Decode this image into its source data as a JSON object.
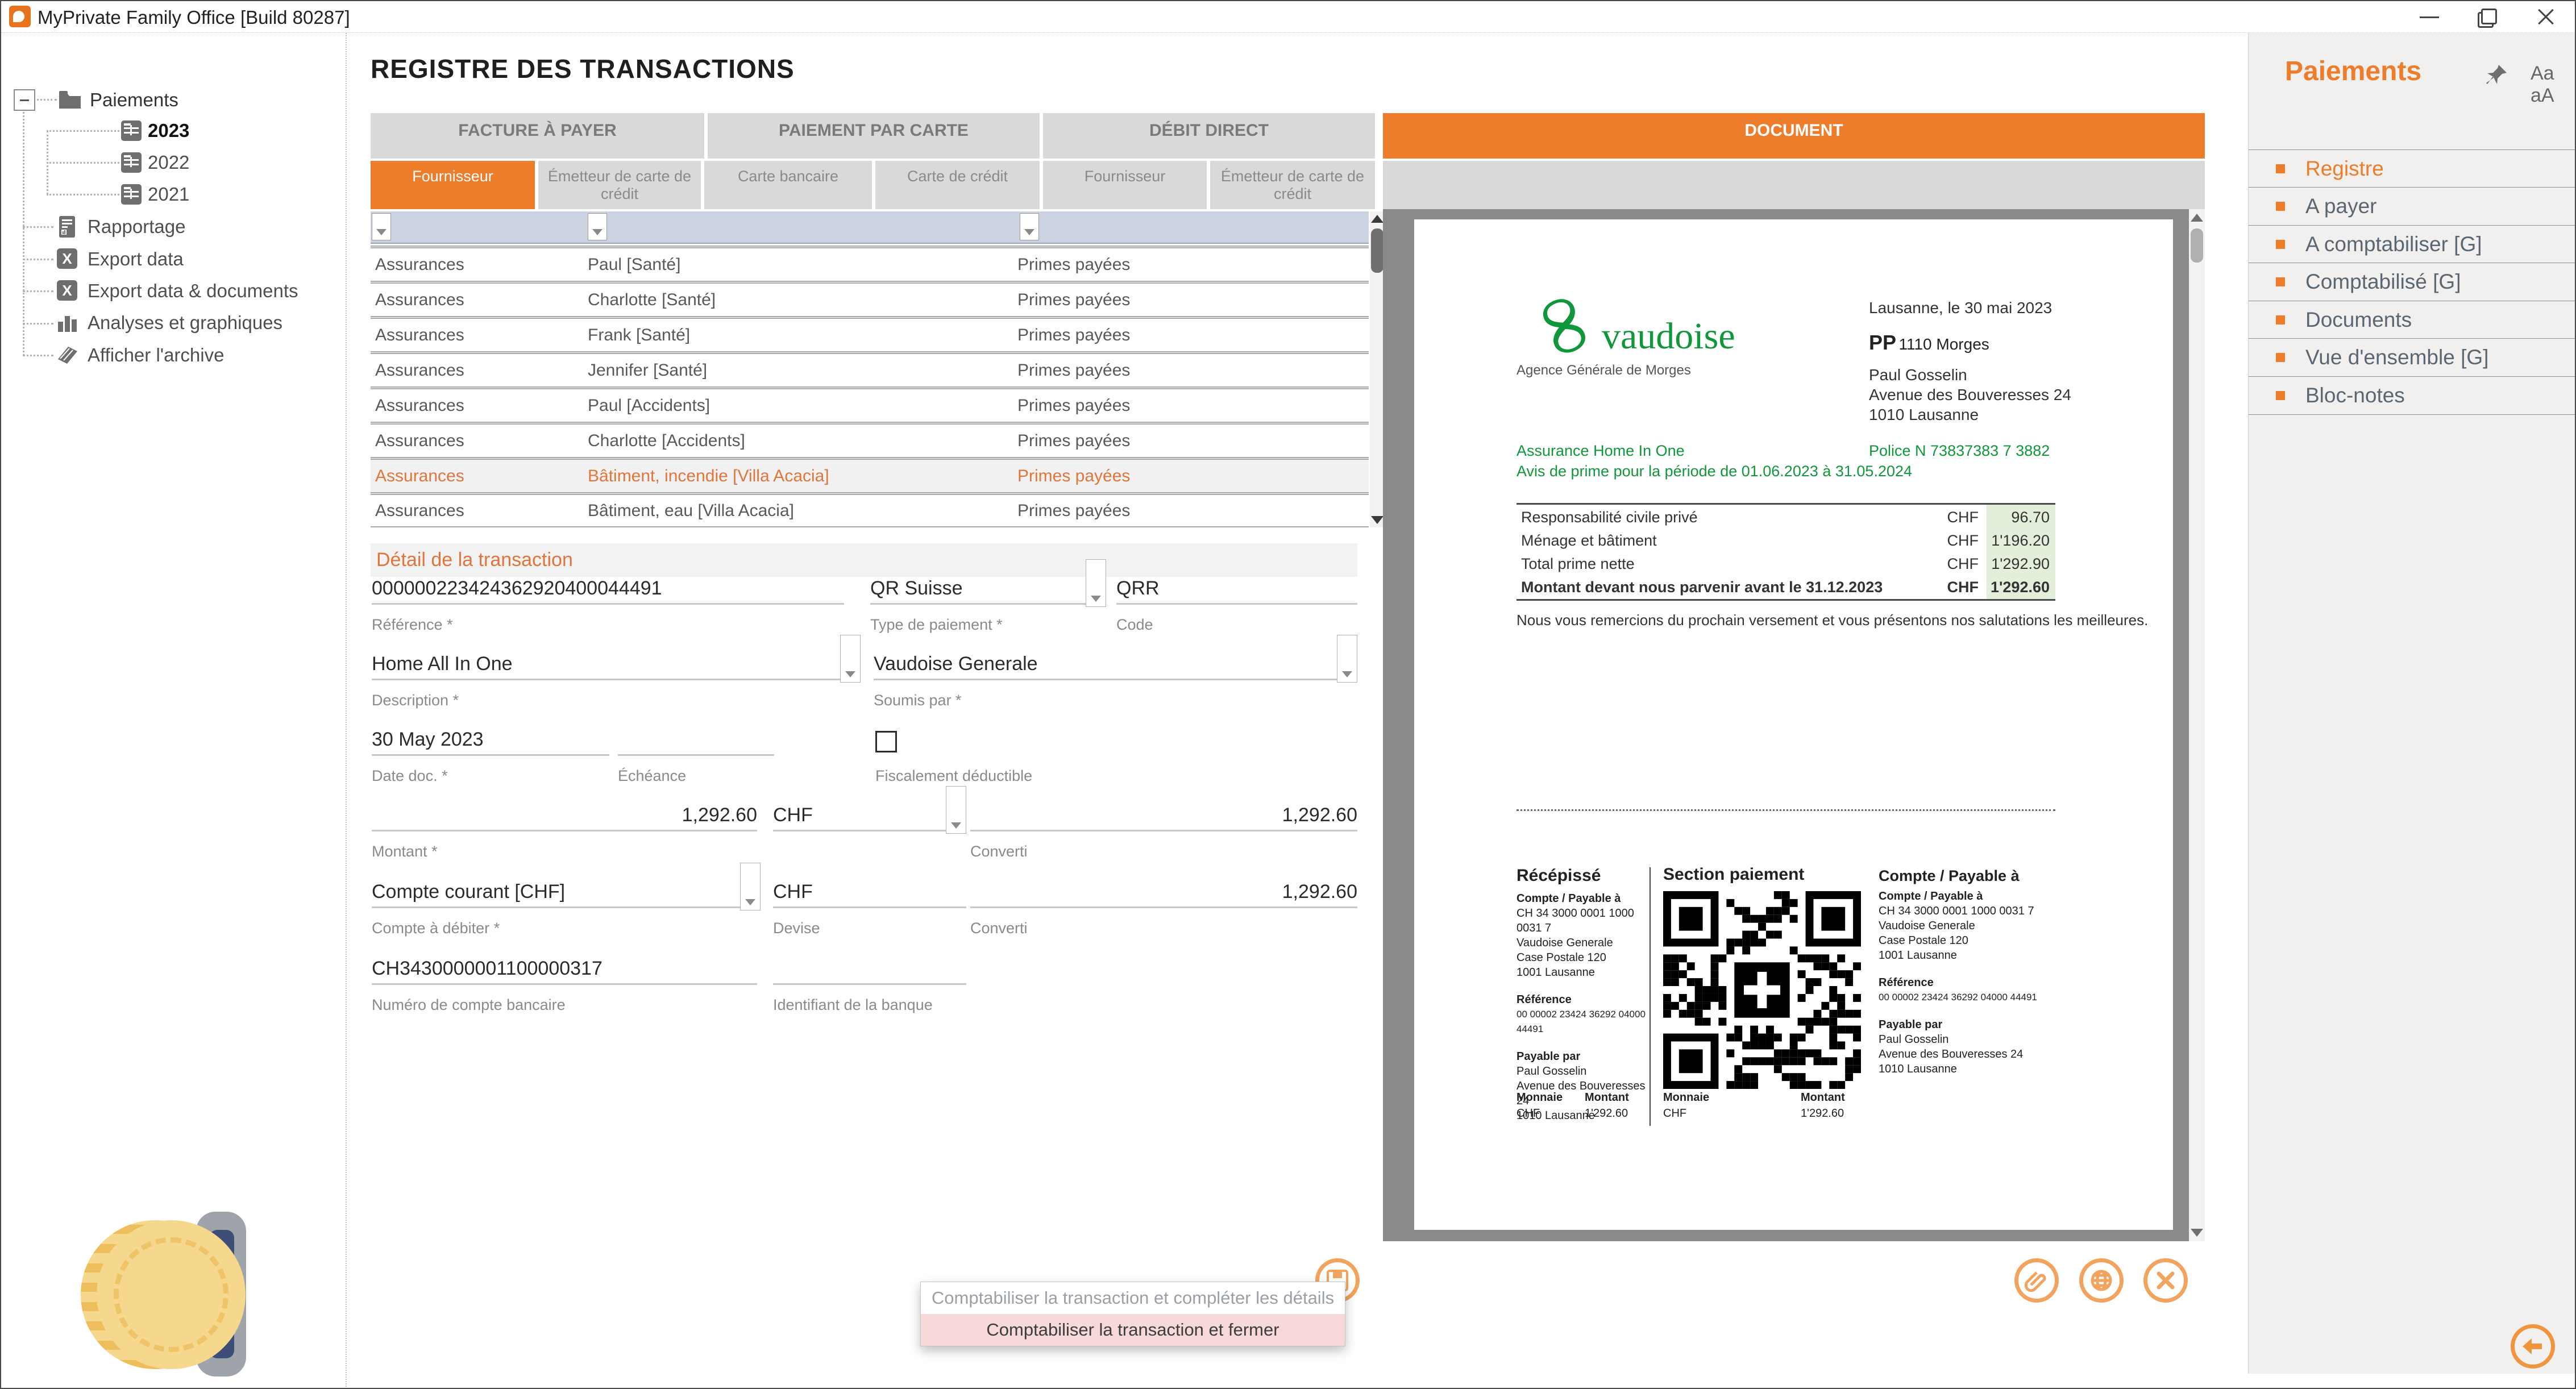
{
  "window": {
    "title": "MyPrivate Family Office [Build 80287]"
  },
  "colors": {
    "accent": "#ED7C2B",
    "doc_green": "#11973B",
    "amount_bg": "#E3EFDB",
    "popup_highlight": "#F7D9D9"
  },
  "tree": {
    "root": "Paiements",
    "years": [
      {
        "label": "2023",
        "active": true
      },
      {
        "label": "2022",
        "active": false
      },
      {
        "label": "2021",
        "active": false
      }
    ],
    "items": [
      "Rapportage",
      "Export data",
      "Export data & documents",
      "Analyses et graphiques",
      "Afficher l'archive"
    ]
  },
  "registre": {
    "title": "REGISTRE DES TRANSACTIONS",
    "groups": [
      "FACTURE À PAYER",
      "PAIEMENT PAR CARTE",
      "DÉBIT DIRECT",
      "DOCUMENT"
    ],
    "columns": [
      "Fournisseur",
      "Émetteur de carte de crédit",
      "Carte bancaire",
      "Carte de crédit",
      "Fournisseur",
      "Émetteur de carte de crédit"
    ],
    "rows": [
      {
        "fournisseur": "Assurances",
        "description": "Paul [Santé]",
        "statut": "Primes payées"
      },
      {
        "fournisseur": "Assurances",
        "description": "Charlotte [Santé]",
        "statut": "Primes payées"
      },
      {
        "fournisseur": "Assurances",
        "description": "Frank [Santé]",
        "statut": "Primes payées"
      },
      {
        "fournisseur": "Assurances",
        "description": "Jennifer [Santé]",
        "statut": "Primes payées"
      },
      {
        "fournisseur": "Assurances",
        "description": "Paul [Accidents]",
        "statut": "Primes payées"
      },
      {
        "fournisseur": "Assurances",
        "description": "Charlotte [Accidents]",
        "statut": "Primes payées"
      },
      {
        "fournisseur": "Assurances",
        "description": "Bâtiment, incendie [Villa Acacia]",
        "statut": "Primes payées",
        "selected": true
      },
      {
        "fournisseur": "Assurances",
        "description": "Bâtiment, eau [Villa Acacia]",
        "statut": "Primes payées"
      }
    ]
  },
  "detail": {
    "title": "Détail de la transaction",
    "reference": {
      "value": "000000223424362920400044491",
      "label": "Référence *"
    },
    "payment_type": {
      "value": "QR Suisse",
      "label": "Type de paiement *"
    },
    "code": {
      "value": "QRR",
      "label": "Code"
    },
    "description": {
      "value": "Home All In One",
      "label": "Description *"
    },
    "submitted_by": {
      "value": "Vaudoise Generale",
      "label": "Soumis par *"
    },
    "doc_date": {
      "value": "30 May 2023",
      "label": "Date doc. *"
    },
    "due_date": {
      "value": "",
      "label": "Échéance"
    },
    "tax_deductible": {
      "label": "Fiscalement déductible",
      "checked": false
    },
    "amount": {
      "value": "1,292.60",
      "label": "Montant *"
    },
    "currency": {
      "value": "CHF"
    },
    "converted": {
      "value": "1,292.60",
      "label": "Converti"
    },
    "debit_account": {
      "value": "Compte courant [CHF]",
      "label": "Compte à débiter *"
    },
    "account_currency": {
      "value": "CHF",
      "label": "Devise"
    },
    "converted2": {
      "value": "1,292.60",
      "label": "Converti"
    },
    "bank_account": {
      "value": "CH3430000001100000317",
      "label": "Numéro de compte bancaire"
    },
    "bank_id": {
      "value": "",
      "label": "Identifiant de la banque"
    }
  },
  "doc": {
    "header": "DOCUMENT",
    "brand": "vaudoise",
    "agency": "Agence Générale de Morges",
    "place_date": "Lausanne, le 30 mai 2023",
    "pp": "PP",
    "pp_city": "1110 Morges",
    "recipient": [
      "Paul Gosselin",
      "Avenue des Bouveresses 24",
      "1010 Lausanne"
    ],
    "policy_title": "Assurance Home In One",
    "policy_subtitle": "Avis de prime pour la période de 01.06.2023 à 31.05.2024",
    "policy_number": "Police N 73837383 7 3882",
    "amounts": [
      {
        "label": "Responsabilité civile privé",
        "currency": "CHF",
        "value": "96.70"
      },
      {
        "label": "Ménage et bâtiment",
        "currency": "CHF",
        "value": "1'196.20"
      },
      {
        "label": "Total prime nette",
        "currency": "CHF",
        "value": "1'292.90"
      },
      {
        "label": "Montant devant nous parvenir avant le 31.12.2023",
        "currency": "CHF",
        "value": "1'292.60"
      }
    ],
    "closing": "Nous vous remercions du prochain versement et vous présentons nos salutations les meilleures.",
    "slip": {
      "receipt_title": "Récépissé",
      "payment_title": "Section paiement",
      "account_label": "Compte / Payable à",
      "iban": "CH 34 3000 0001 1000 0031 7",
      "creditor": [
        "Vaudoise Generale",
        "Case Postale 120",
        "1001 Lausanne"
      ],
      "reference_label": "Référence",
      "reference": "00 00002 23424 36292 04000 44491",
      "payer_label": "Payable par",
      "payer": [
        "Paul Gosselin",
        "Avenue des Bouveresses 24",
        "1010 Lausanne"
      ],
      "currency_label": "Monnaie",
      "currency": "CHF",
      "amount_label": "Montant",
      "amount": "1'292.60"
    }
  },
  "popup": {
    "items": [
      {
        "label": "Comptabiliser la transaction et compléter les détails",
        "highlighted": false
      },
      {
        "label": "Comptabiliser la transaction et fermer",
        "highlighted": true
      }
    ]
  },
  "panel": {
    "title": "Paiements",
    "font_small": "Aa",
    "font_large": "aA",
    "items": [
      {
        "label": "Registre",
        "active": true
      },
      {
        "label": "A payer"
      },
      {
        "label": "A comptabiliser [G]"
      },
      {
        "label": "Comptabilisé [G]"
      },
      {
        "label": "Documents"
      },
      {
        "label": "Vue d'ensemble [G]"
      },
      {
        "label": "Bloc-notes"
      }
    ]
  }
}
